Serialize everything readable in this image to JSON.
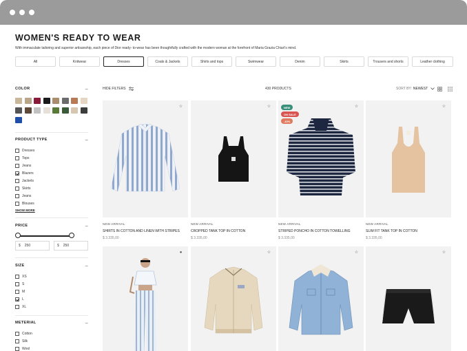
{
  "window": {
    "dots": [
      "dot-1",
      "dot-2",
      "dot-3"
    ]
  },
  "page": {
    "title": "WOMEN'S READY TO WEAR",
    "intro": "With immaculate tailoring and superior artisanship, each piece of Dior ready- to-wear has been thoughtfully crafted with the modern woman at the forefront of Maria Grazia Chiuri's mind."
  },
  "categories": [
    {
      "label": "All",
      "active": false
    },
    {
      "label": "Knitwear",
      "active": false
    },
    {
      "label": "Dresses",
      "active": true
    },
    {
      "label": "Coats & Jackets",
      "active": false
    },
    {
      "label": "Shirts and tops",
      "active": false
    },
    {
      "label": "Swimwear",
      "active": false
    },
    {
      "label": "Denim",
      "active": false
    },
    {
      "label": "Skirts",
      "active": false
    },
    {
      "label": "Trousers and shorts",
      "active": false
    },
    {
      "label": "Leather clothing",
      "active": false
    }
  ],
  "filters": {
    "color": {
      "label": "COLOR",
      "swatches": [
        "#c9b79c",
        "#b8a58a",
        "#8b1a3a",
        "#1a1a1a",
        "#a98d6d",
        "#6b6b6b",
        "#b87a55",
        "#e4d6c3",
        "#555555",
        "#5f4a3a",
        "#c2c2c2",
        "#e6e0d8",
        "#5a7a3a",
        "#3a5a3a",
        "#d8c7b0",
        "#3c3c3c",
        "#1f4fa8"
      ]
    },
    "product_type": {
      "label": "PRODUCT TYPE",
      "options": [
        {
          "label": "Dresses",
          "checked": false
        },
        {
          "label": "Tops",
          "checked": false
        },
        {
          "label": "Jeans",
          "checked": false
        },
        {
          "label": "Blazers",
          "checked": true
        },
        {
          "label": "Jackets",
          "checked": false
        },
        {
          "label": "Skirts",
          "checked": false
        },
        {
          "label": "Jeans",
          "checked": false
        },
        {
          "label": "Blouses",
          "checked": false
        }
      ],
      "show_more": "SHOW MORE"
    },
    "price": {
      "label": "PRICE",
      "min_currency": "$",
      "min_value": "250",
      "max_currency": "$",
      "max_value": "250"
    },
    "size": {
      "label": "SIZE",
      "options": [
        {
          "label": "XS",
          "checked": false
        },
        {
          "label": "S",
          "checked": false
        },
        {
          "label": "M",
          "checked": false
        },
        {
          "label": "L",
          "checked": true
        },
        {
          "label": "XL",
          "checked": false
        }
      ]
    },
    "material": {
      "label": "METERIAL",
      "options": [
        {
          "label": "Cotton",
          "checked": false
        },
        {
          "label": "Silk",
          "checked": false
        },
        {
          "label": "Wool",
          "checked": false
        }
      ]
    }
  },
  "toolbar": {
    "hide_filters": "HIDE FILTERS",
    "count": "430 PRODUCTS",
    "sort_label": "SORT BY:",
    "sort_value": "NEWEST"
  },
  "products": [
    {
      "tag": "NEW ARRIVAL",
      "name": "SHIRTS IN COTTON AND LINEN WITH STRIPES",
      "price": "$ 3.335,00",
      "badges": []
    },
    {
      "tag": "NEW ARRIVAL",
      "name": "CROPPED TANK TOP IN COTTON",
      "price": "$ 3.335,00",
      "badges": []
    },
    {
      "tag": "NEW ARRIVAL",
      "name": "STRIPED PONCHO IN COTTON TOWELLING",
      "price": "$ 3.335,00",
      "badges": [
        {
          "label": "NEW",
          "color": "#3a8f7a"
        },
        {
          "label": "ON SALE",
          "color": "#d9534f"
        },
        {
          "label": "-10%",
          "color": "#e07a5f"
        }
      ]
    },
    {
      "tag": "NEW ARRIVAL",
      "name": "SLIM FIT TANK TOP IN COTTON",
      "price": "$ 3.335,00",
      "badges": []
    },
    {
      "tag": "",
      "name": "",
      "price": "",
      "badges": []
    },
    {
      "tag": "",
      "name": "",
      "price": "",
      "badges": []
    },
    {
      "tag": "",
      "name": "",
      "price": "",
      "badges": []
    },
    {
      "tag": "",
      "name": "",
      "price": "",
      "badges": []
    }
  ]
}
